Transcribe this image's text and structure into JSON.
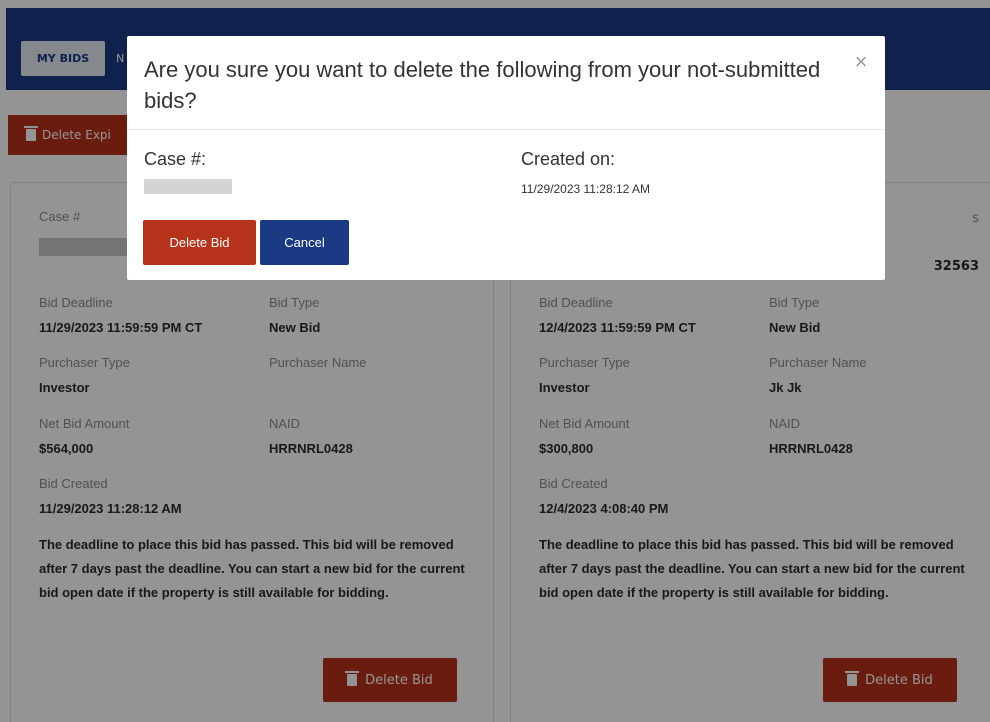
{
  "nav": {
    "my_bids": "MY BIDS",
    "second_item": "N"
  },
  "toolbar": {
    "delete_expired_label": "Delete Expi"
  },
  "cards": [
    {
      "case_label": "Case #",
      "case_extra": "",
      "case_extra_value": "",
      "bid_deadline_label": "Bid Deadline",
      "bid_deadline": "11/29/2023 11:59:59 PM CT",
      "bid_type_label": "Bid Type",
      "bid_type": "New Bid",
      "purchaser_type_label": "Purchaser Type",
      "purchaser_type": "Investor",
      "purchaser_name_label": "Purchaser Name",
      "purchaser_name": "",
      "net_bid_label": "Net Bid Amount",
      "net_bid": "$564,000",
      "naid_label": "NAID",
      "naid": "HRRNRL0428",
      "bid_created_label": "Bid Created",
      "bid_created": "11/29/2023 11:28:12 AM",
      "note": "The deadline to place this bid has passed. This bid will be removed after 7 days past the deadline. You can start a new bid for the current bid open date if the property is still available for bidding.",
      "delete_label": "Delete Bid"
    },
    {
      "case_label": "",
      "case_extra": "s",
      "case_extra_value": "32563",
      "bid_deadline_label": "Bid Deadline",
      "bid_deadline": "12/4/2023 11:59:59 PM CT",
      "bid_type_label": "Bid Type",
      "bid_type": "New Bid",
      "purchaser_type_label": "Purchaser Type",
      "purchaser_type": "Investor",
      "purchaser_name_label": "Purchaser Name",
      "purchaser_name": "Jk Jk",
      "net_bid_label": "Net Bid Amount",
      "net_bid": "$300,800",
      "naid_label": "NAID",
      "naid": "HRRNRL0428",
      "bid_created_label": "Bid Created",
      "bid_created": "12/4/2023 4:08:40 PM",
      "note": "The deadline to place this bid has passed. This bid will be removed after 7 days past the deadline. You can start a new bid for the current bid open date if the property is still available for bidding.",
      "delete_label": "Delete Bid"
    }
  ],
  "modal": {
    "title": "Are you sure you want to delete the following from your not-submitted bids?",
    "close_glyph": "×",
    "case_label": "Case #:",
    "created_label": "Created on:",
    "created_value": "11/29/2023 11:28:12 AM",
    "delete_button": "Delete Bid",
    "cancel_button": "Cancel"
  },
  "colors": {
    "brand_navy": "#1a3a83",
    "danger_red": "#b7321a",
    "overlay": "rgba(0,0,0,0.42)"
  },
  "icons": {
    "trash": "trash-icon",
    "close": "close-icon"
  }
}
